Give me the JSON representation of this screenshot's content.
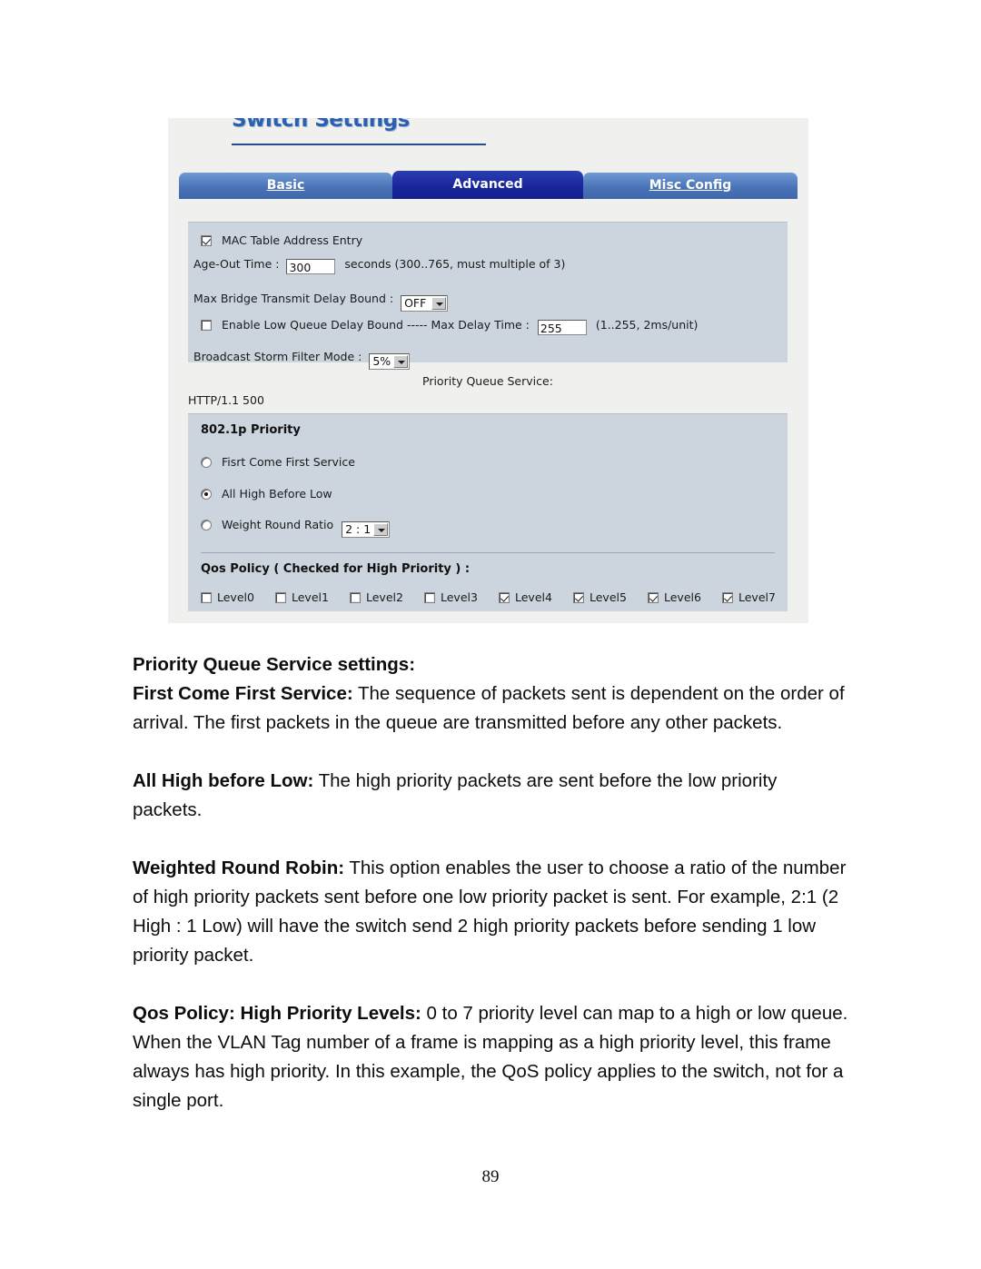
{
  "figure": {
    "app_title": "Switch Settings",
    "tabs": [
      {
        "label": "Basic",
        "active": false
      },
      {
        "label": "Advanced",
        "active": true
      },
      {
        "label": "Misc Config",
        "active": false
      }
    ],
    "basic_panel": {
      "mac_table_checkbox_label": "MAC Table Address Entry",
      "mac_table_checked": "true",
      "age_out_label": "Age-Out Time :",
      "age_out_value": "300",
      "age_out_hint": "seconds (300..765, must multiple of 3)",
      "max_bridge_label": "Max Bridge Transmit Delay Bound :",
      "max_bridge_value": "OFF",
      "low_queue_label": "Enable Low Queue Delay Bound ----- Max Delay Time :",
      "low_queue_checked": "false",
      "max_delay_value": "255",
      "max_delay_hint": "(1..255, 2ms/unit)",
      "broadcast_label": "Broadcast Storm Filter Mode :",
      "broadcast_value": "5%"
    },
    "priority_section": {
      "section_caption": "Priority Queue Service:",
      "http_status": "HTTP/1.1 500",
      "heading": "802.1p Priority",
      "radios": [
        {
          "label": "Fisrt Come First Service",
          "selected": "false"
        },
        {
          "label": "All High Before Low",
          "selected": "true"
        },
        {
          "label": "Weight Round Ratio",
          "selected": "false"
        }
      ],
      "weight_ratio_value": "2 : 1",
      "qos_heading": "Qos Policy ( Checked for High Priority ) :",
      "levels": [
        {
          "label": "Level0",
          "checked": "false"
        },
        {
          "label": "Level1",
          "checked": "false"
        },
        {
          "label": "Level2",
          "checked": "false"
        },
        {
          "label": "Level3",
          "checked": "false"
        },
        {
          "label": "Level4",
          "checked": "true"
        },
        {
          "label": "Level5",
          "checked": "true"
        },
        {
          "label": "Level6",
          "checked": "true"
        },
        {
          "label": "Level7",
          "checked": "true"
        }
      ]
    },
    "colors": {
      "active_tab": "#18249b",
      "inactive_tab": "#4a74b8",
      "panel_bg": "#ccd5dd",
      "title_blue": "#2c5fad"
    }
  },
  "document": {
    "heading": "Priority Queue Service settings:",
    "paragraphs": [
      {
        "lead": "First Come First Service:",
        "body": " The sequence of packets sent is dependent on the order of arrival.  The first packets in the queue are transmitted before any other packets."
      },
      {
        "lead": "All High before Low:",
        "body": " The high priority packets are sent before the low priority packets."
      },
      {
        "lead": "Weighted Round Robin:",
        "body": " This option enables the user to choose a ratio of the number of high priority packets sent before one low priority packet is sent. For example, 2:1 (2 High : 1 Low) will have the switch send 2 high priority packets before sending 1 low priority packet."
      },
      {
        "lead": "Qos Policy: High Priority Levels:",
        "body": " 0 to 7 priority level can map to a high or low queue. When the VLAN Tag number of a frame is mapping as a high priority level, this frame always has high priority. In this example, the QoS policy applies to the switch, not for a single port."
      }
    ],
    "page_number": "89"
  }
}
